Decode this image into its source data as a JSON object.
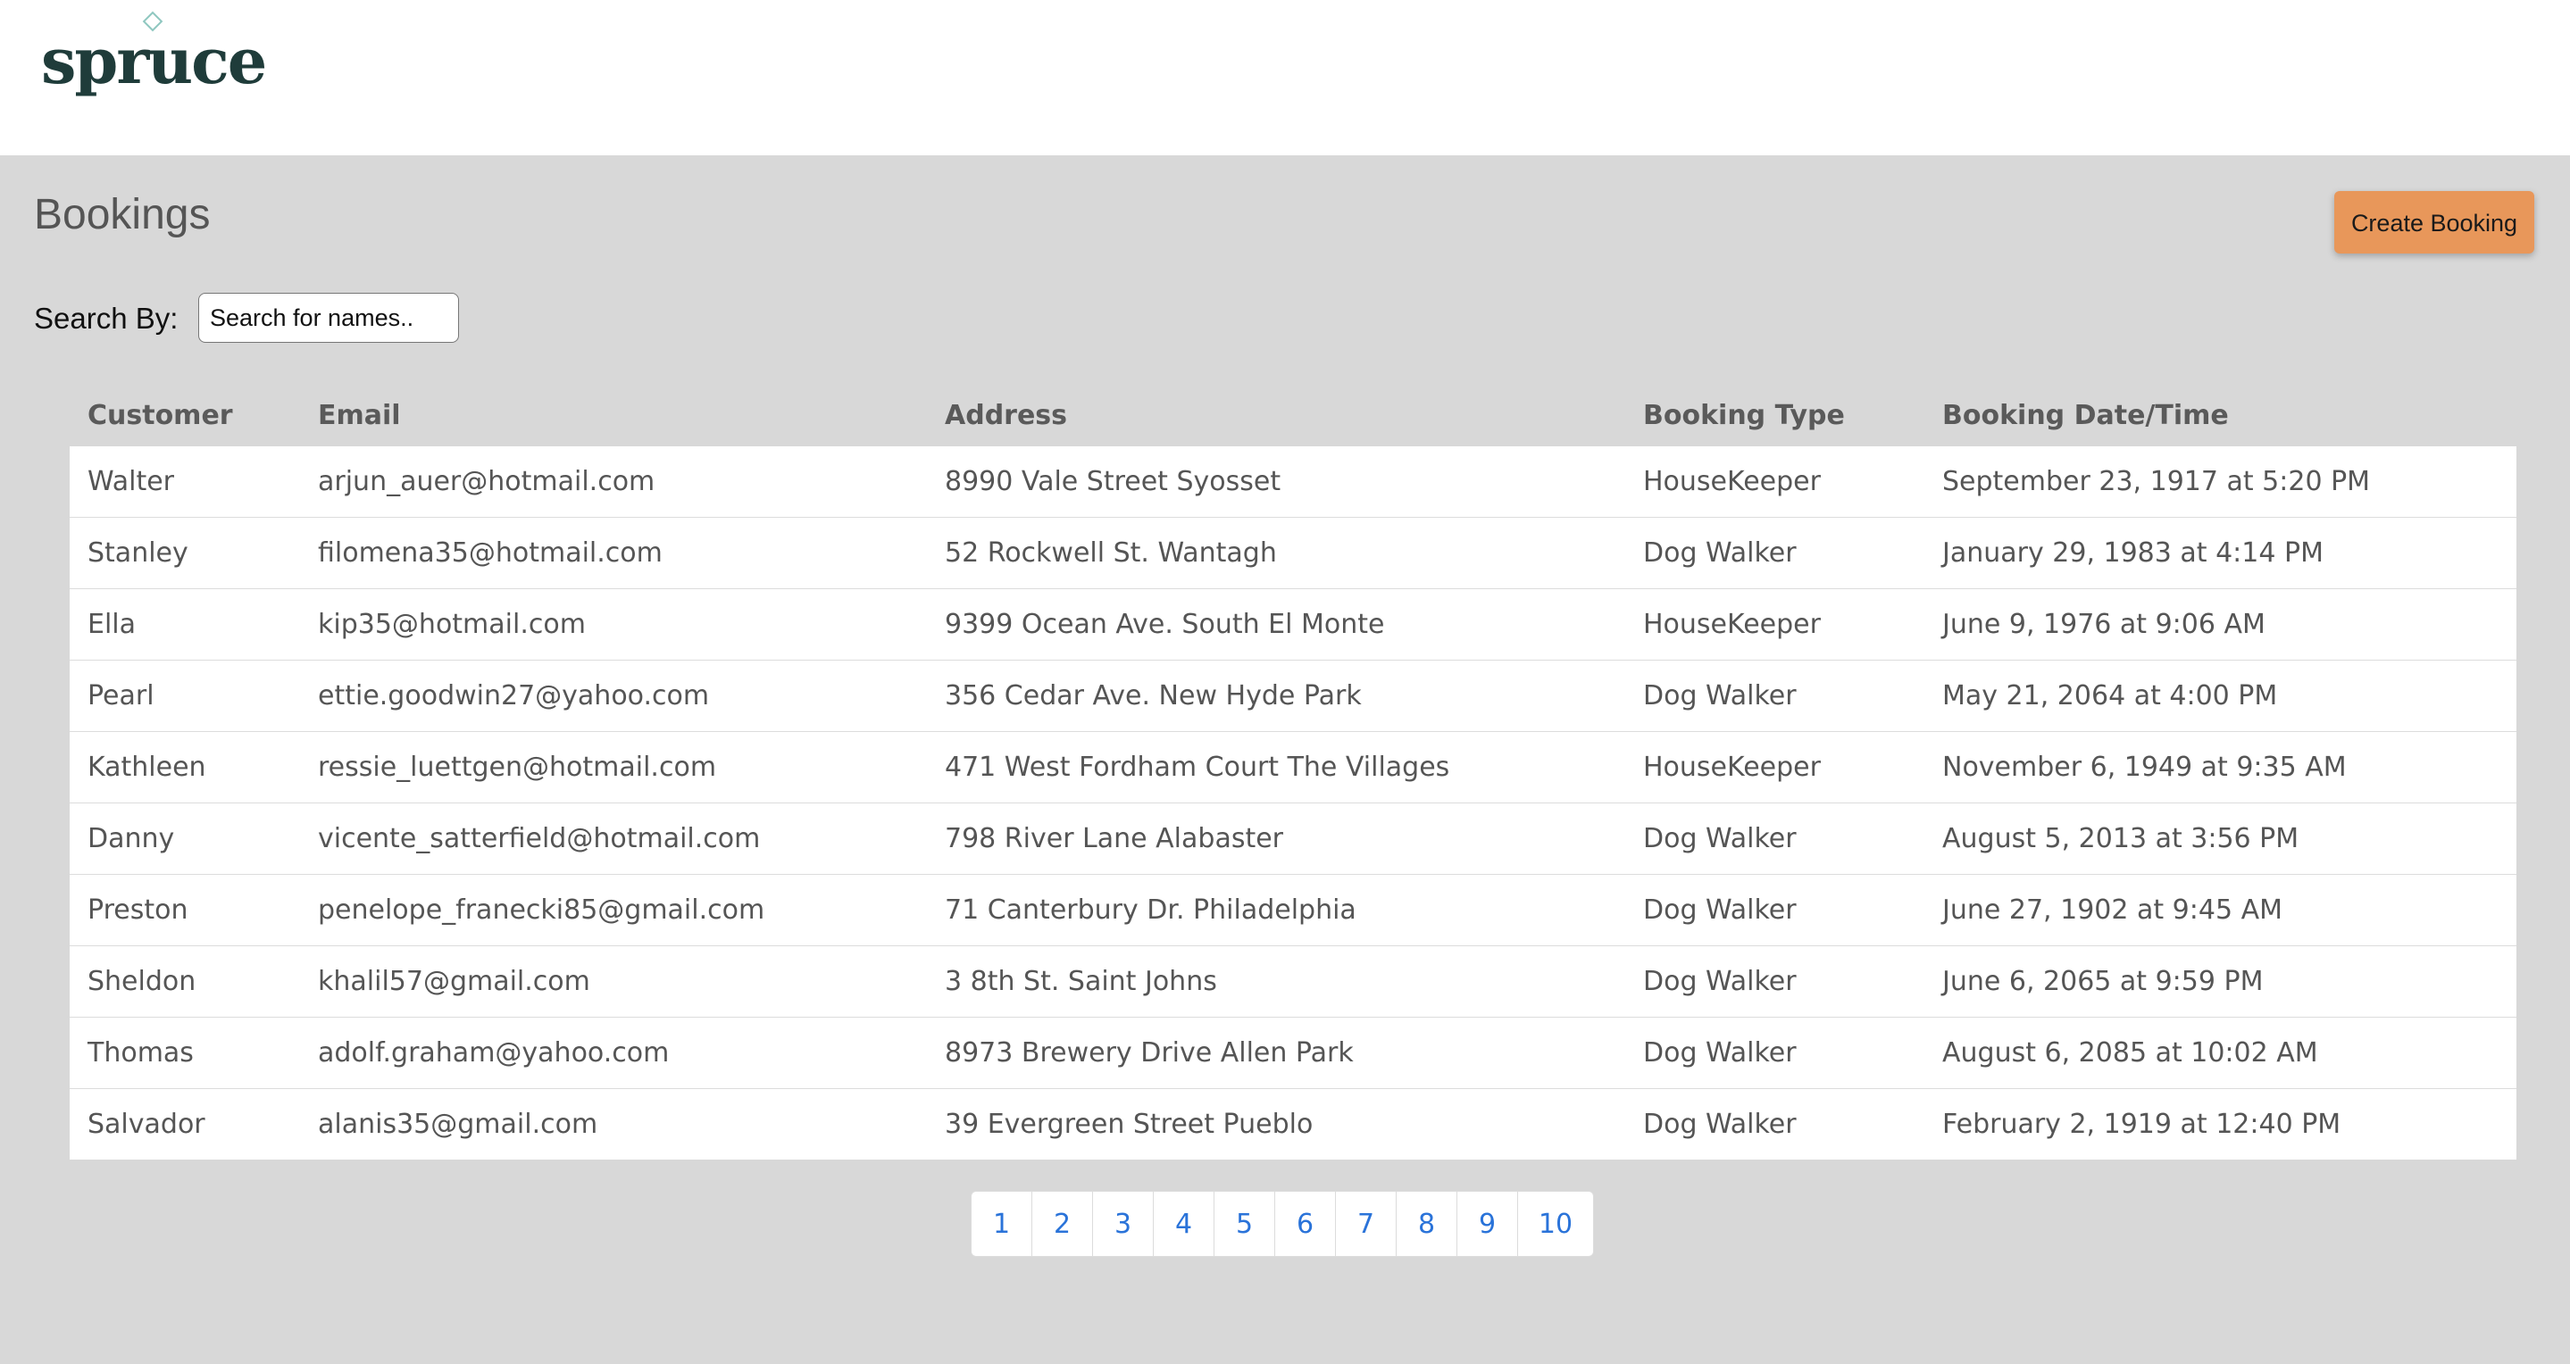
{
  "header": {
    "logo_text": "spruce"
  },
  "page": {
    "title": "Bookings",
    "create_button_label": "Create Booking"
  },
  "search": {
    "label": "Search By:",
    "placeholder": "Search for names.."
  },
  "table": {
    "columns": [
      "Customer",
      "Email",
      "Address",
      "Booking Type",
      "Booking Date/Time"
    ],
    "rows": [
      [
        "Walter",
        "arjun_auer@hotmail.com",
        "8990 Vale Street Syosset",
        "HouseKeeper",
        "September 23, 1917 at 5:20 PM"
      ],
      [
        "Stanley",
        "filomena35@hotmail.com",
        "52 Rockwell St. Wantagh",
        "Dog Walker",
        "January 29, 1983 at 4:14 PM"
      ],
      [
        "Ella",
        "kip35@hotmail.com",
        "9399 Ocean Ave. South El Monte",
        "HouseKeeper",
        "June 9, 1976 at 9:06 AM"
      ],
      [
        "Pearl",
        "ettie.goodwin27@yahoo.com",
        "356 Cedar Ave. New Hyde Park",
        "Dog Walker",
        "May 21, 2064 at 4:00 PM"
      ],
      [
        "Kathleen",
        "ressie_luettgen@hotmail.com",
        "471 West Fordham Court The Villages",
        "HouseKeeper",
        "November 6, 1949 at 9:35 AM"
      ],
      [
        "Danny",
        "vicente_satterfield@hotmail.com",
        "798 River Lane Alabaster",
        "Dog Walker",
        "August 5, 2013 at 3:56 PM"
      ],
      [
        "Preston",
        "penelope_franecki85@gmail.com",
        "71 Canterbury Dr. Philadelphia",
        "Dog Walker",
        "June 27, 1902 at 9:45 AM"
      ],
      [
        "Sheldon",
        "khalil57@gmail.com",
        "3 8th St. Saint Johns",
        "Dog Walker",
        "June 6, 2065 at 9:59 PM"
      ],
      [
        "Thomas",
        "adolf.graham@yahoo.com",
        "8973 Brewery Drive Allen Park",
        "Dog Walker",
        "August 6, 2085 at 10:02 AM"
      ],
      [
        "Salvador",
        "alanis35@gmail.com",
        "39 Evergreen Street Pueblo",
        "Dog Walker",
        "February 2, 1919 at 12:40 PM"
      ]
    ]
  },
  "pagination": {
    "pages": [
      "1",
      "2",
      "3",
      "4",
      "5",
      "6",
      "7",
      "8",
      "9",
      "10"
    ]
  },
  "colors": {
    "background": "#d8d8d8",
    "header_background": "#ffffff",
    "accent_button": "#e8975a",
    "link": "#2a73d9",
    "logo": "#1f3c3a"
  }
}
